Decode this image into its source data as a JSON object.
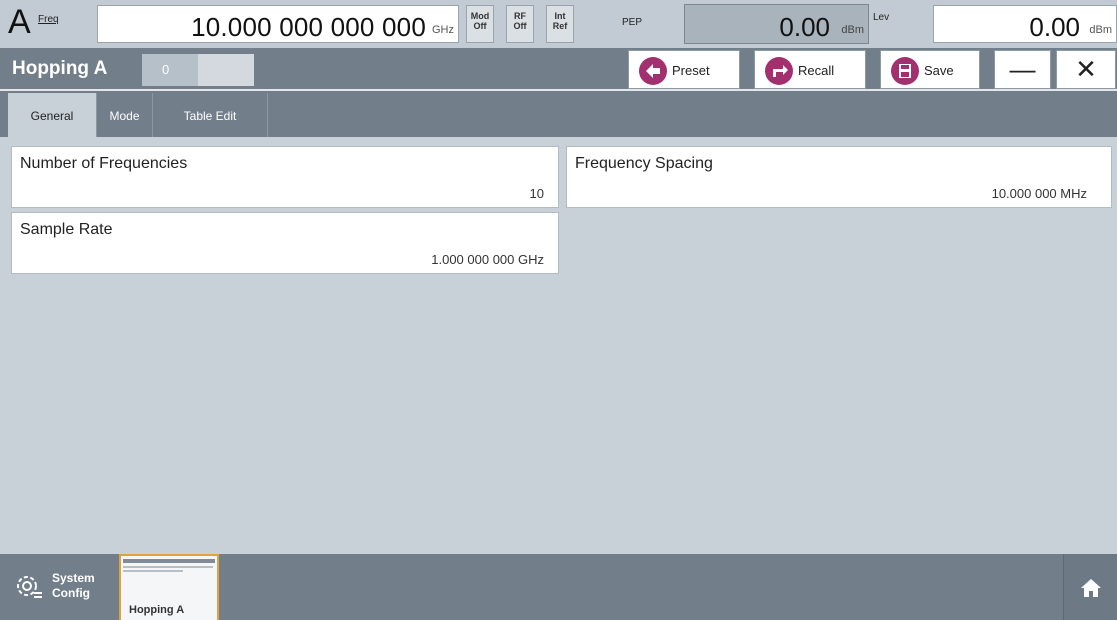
{
  "status": {
    "channel": "A",
    "freq_label": "Freq",
    "frequency": "10.000 000 000 000",
    "freq_unit": "GHz",
    "mod": [
      "Mod",
      "Off"
    ],
    "rf": [
      "RF",
      "Off"
    ],
    "ref": [
      "Int",
      "Ref"
    ],
    "pep_label": "PEP",
    "pep_value": "0.00",
    "pep_unit": "dBm",
    "lev_label": "Lev",
    "lev_value": "0.00",
    "lev_unit": "dBm"
  },
  "dialog": {
    "title": "Hopping A",
    "index_value": "0",
    "preset_label": "Preset",
    "recall_label": "Recall",
    "save_label": "Save",
    "minimize_glyph": "—",
    "close_glyph": "✕"
  },
  "tabs": [
    {
      "label": "General",
      "active": true
    },
    {
      "label": "Mode",
      "active": false
    },
    {
      "label": "Table Edit",
      "active": false
    }
  ],
  "fields": {
    "num_freq": {
      "label": "Number of Frequencies",
      "value": "10"
    },
    "freq_spacing": {
      "label": "Frequency Spacing",
      "value": "10.000 000  MHz"
    },
    "sample_rate": {
      "label": "Sample Rate",
      "value": "1.000 000 000  GHz"
    }
  },
  "taskbar": {
    "system_config": [
      "System",
      "Config"
    ],
    "window_thumb_label": "Hopping A",
    "home_icon": "house-icon"
  },
  "colors": {
    "accent": "#a3306e",
    "highlight": "#e0a33c"
  }
}
